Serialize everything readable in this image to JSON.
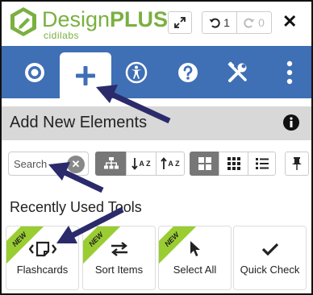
{
  "header": {
    "brand": "DesignPLUS",
    "brand_main": "Design",
    "brand_plus": "PLUS",
    "subbrand": "cidilabs",
    "undo_count": "1",
    "redo_count": "0",
    "close_symbol": "✕"
  },
  "tabs": [
    {
      "name": "target-icon",
      "active": false
    },
    {
      "name": "plus-icon",
      "active": true
    },
    {
      "name": "accessibility-icon",
      "active": false
    },
    {
      "name": "help-icon",
      "active": false
    },
    {
      "name": "tools-icon",
      "active": false
    },
    {
      "name": "more-vertical-icon",
      "active": false
    }
  ],
  "section": {
    "title": "Add New Elements"
  },
  "toolbar": {
    "search_placeholder": "Search",
    "search_value": "",
    "sort_az": "A Z",
    "sort_za": "A Z"
  },
  "recent": {
    "title": "Recently Used Tools",
    "badge": "NEW",
    "cards": [
      {
        "label": "Flashcards",
        "icon": "flashcards-icon",
        "is_new": true
      },
      {
        "label": "Sort Items",
        "icon": "sort-arrows-icon",
        "is_new": true
      },
      {
        "label": "Select All",
        "icon": "cursor-icon",
        "is_new": true
      },
      {
        "label": "Quick Check",
        "icon": "checkmark-icon",
        "is_new": false
      }
    ]
  },
  "colors": {
    "brand_green": "#7ab040",
    "tab_blue": "#3f6fb5",
    "ribbon_green": "#9acd32",
    "arrow_navy": "#2b2a6b"
  }
}
